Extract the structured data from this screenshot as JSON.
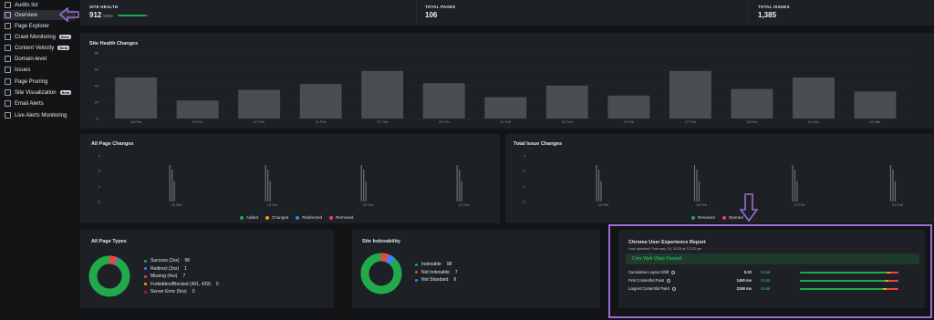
{
  "sidebar": {
    "items": [
      {
        "label": "Audits list",
        "badge": ""
      },
      {
        "label": "Overview",
        "badge": ""
      },
      {
        "label": "Page Explorer",
        "badge": ""
      },
      {
        "label": "Crawl Monitoring",
        "badge": "Beta"
      },
      {
        "label": "Content Velocity",
        "badge": "Beta"
      },
      {
        "label": "Domain-level",
        "badge": ""
      },
      {
        "label": "Issues",
        "badge": ""
      },
      {
        "label": "Page Pruning",
        "badge": ""
      },
      {
        "label": "Site Visualization",
        "badge": "Beta"
      },
      {
        "label": "Email Alerts",
        "badge": ""
      },
      {
        "label": "Live Alerts Monitoring",
        "badge": ""
      }
    ]
  },
  "stats": {
    "site_health_label": "SITE HEALTH",
    "site_health_value": "912",
    "site_health_max": "/1000",
    "site_health_fraction": 0.912,
    "total_pages_label": "TOTAL PAGES",
    "total_pages_value": "106",
    "total_issues_label": "TOTAL ISSUES",
    "total_issues_value": "1,385"
  },
  "colors": {
    "accent_green": "#22a94a",
    "changed_orange": "#f59e0b",
    "redirected_blue": "#3b82f6",
    "removed_red": "#ef4444",
    "bar_gray": "#4a4e53",
    "annotation_purple": "#9b6bd6"
  },
  "site_health_chart": {
    "title": "Site Health Changes",
    "chart_data": {
      "type": "bar",
      "categories": [
        "18 Feb",
        "19 Feb",
        "20 Feb",
        "21 Feb",
        "22 Feb",
        "23 Feb",
        "24 Feb",
        "25 Feb",
        "26 Feb",
        "27 Feb",
        "28 Feb",
        "01 Mar",
        "02 Mar"
      ],
      "values": [
        50,
        22,
        35,
        42,
        58,
        43,
        26,
        40,
        28,
        58,
        36,
        50,
        33
      ],
      "ylim": [
        0,
        60
      ],
      "yticks": [
        "0",
        "20",
        "40",
        "60",
        "80"
      ]
    }
  },
  "all_page_changes": {
    "title": "All Page Changes",
    "legend": [
      "Added",
      "Changed",
      "Redirected",
      "Removed"
    ],
    "chart_data": {
      "type": "bar",
      "categories": [
        "18 Feb",
        "19 Feb",
        "20 Feb",
        "21 Feb"
      ],
      "ylim": [
        0,
        3
      ],
      "yticks": [
        "0",
        "1",
        "2",
        "3"
      ]
    }
  },
  "total_issue_changes": {
    "title": "Total Issue Changes",
    "legend": [
      "Resolved",
      "Opened"
    ],
    "chart_data": {
      "type": "bar",
      "categories": [
        "18 Feb",
        "19 Feb",
        "20 Feb",
        "21 Feb"
      ],
      "ylim": [
        0,
        3
      ],
      "yticks": [
        "0",
        "1",
        "2",
        "3"
      ]
    }
  },
  "all_page_types": {
    "title": "All Page Types",
    "items": [
      {
        "label": "Success (2xx)",
        "value": "98",
        "color": "#22a94a"
      },
      {
        "label": "Redirect (3xx)",
        "value": "1",
        "color": "#3b82f6"
      },
      {
        "label": "Missing (4xx)",
        "value": "7",
        "color": "#ef4444"
      },
      {
        "label": "Forbidden/Blocked (401, 429)",
        "value": "0",
        "color": "#f59e0b"
      },
      {
        "label": "Server Error (5xx)",
        "value": "0",
        "color": "#b91c1c"
      }
    ]
  },
  "site_indexability": {
    "title": "Site Indexability",
    "items": [
      {
        "label": "Indexable",
        "value": "98",
        "color": "#22a94a"
      },
      {
        "label": "Not Indexable",
        "value": "7",
        "color": "#ef4444"
      },
      {
        "label": "Not Standard",
        "value": "6",
        "color": "#3b82f6"
      }
    ]
  },
  "cwv": {
    "title": "Chrome User Experience Report",
    "updated": "Last updated: February 19, 2025 at 12:33 pm",
    "status": "Core Web Vitals Passed",
    "metrics": [
      {
        "label": "Cumulative Layout Shift",
        "value": "0.03",
        "status": "Good",
        "fill": 0.88
      },
      {
        "label": "First Contentful Paint",
        "value": "1490 ms",
        "status": "Good",
        "fill": 0.86
      },
      {
        "label": "Largest Contentful Paint",
        "value": "2198 ms",
        "status": "Good",
        "fill": 0.84
      }
    ]
  }
}
